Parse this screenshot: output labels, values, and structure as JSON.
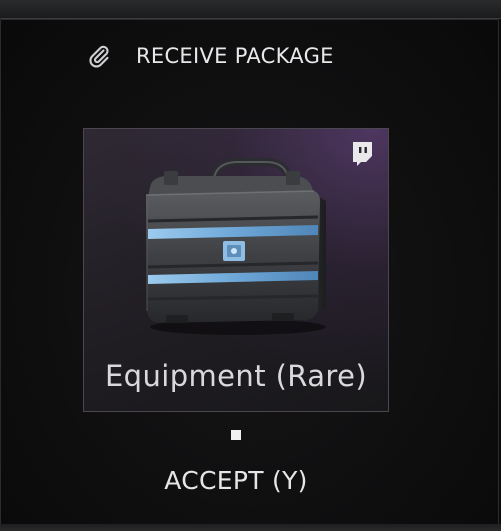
{
  "dialog": {
    "title": "RECEIVE PACKAGE",
    "header_icon": "paperclip-icon"
  },
  "reward": {
    "name": "Equipment (Rare)",
    "platform_icon": "twitch-icon",
    "item_icon": "equipment-case",
    "rarity_color": "#6e4a8c",
    "stripe_color": "#7fb8e0"
  },
  "pagination": {
    "current": 1,
    "total": 1
  },
  "actions": {
    "accept_label": "ACCEPT (Y)"
  }
}
